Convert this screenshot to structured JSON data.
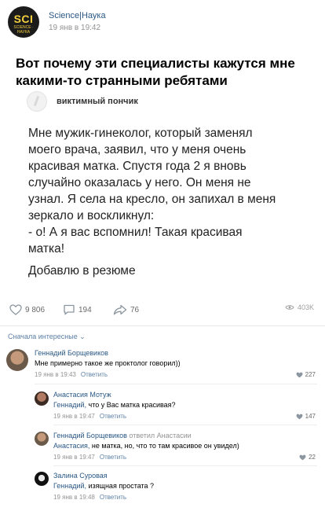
{
  "post": {
    "group_logo": {
      "main": "SCI",
      "sub": "SCIENCE · НАУКА"
    },
    "group_name": "Science|Наука",
    "time": "19 янв в 19:42",
    "title": "Вот почему эти специалисты кажутся мне какими-то странными ребятами"
  },
  "tweet": {
    "author": "виктимный пончик",
    "text": "Мне мужик-гинеколог, который заменял\nмоего врача, заявил, что у меня очень\nкрасивая матка. Спустя года 2 я вновь\nслучайно оказалась у него. Он меня не\nузнал. Я села на кресло, он запихал в меня\nзеркало и воскликнул:\n- о! А я вас вспомнил! Такая красивая\nматка!",
    "extra": "Добавлю в резюме"
  },
  "actions": {
    "likes": "9 806",
    "comments": "194",
    "shares": "76",
    "views": "403K"
  },
  "comments_sort": "Сначала интересные",
  "comments": [
    {
      "author": "Геннадий Борщевиков",
      "text": "Мне примерно такое же проктолог говорил))",
      "time": "19 янв в 19:43",
      "reply_label": "Ответить",
      "likes": "227"
    },
    {
      "author": "Анастасия Мотуж",
      "addressee": "Геннадий,",
      "text": " что у Вас матка красивая?",
      "time": "19 янв в 19:47",
      "reply_label": "Ответить",
      "likes": "147"
    },
    {
      "author": "Геннадий Борщевиков",
      "author_extra": " ответил Анастасии",
      "addressee": "Анастасия,",
      "text": " не матка, но, что то там красивое он увидел)",
      "time": "19 янв в 19:47",
      "reply_label": "Ответить",
      "likes": "22"
    },
    {
      "author": "Залина Суровая",
      "addressee": "Геннадий,",
      "text": " изящная простата ?",
      "time": "19 янв в 19:48",
      "reply_label": "Ответить",
      "likes": ""
    }
  ],
  "colors": {
    "link": "#2a5885",
    "meta": "#939393",
    "logo_bg": "#1b1b1b",
    "logo_fg": "#f4d03f"
  }
}
